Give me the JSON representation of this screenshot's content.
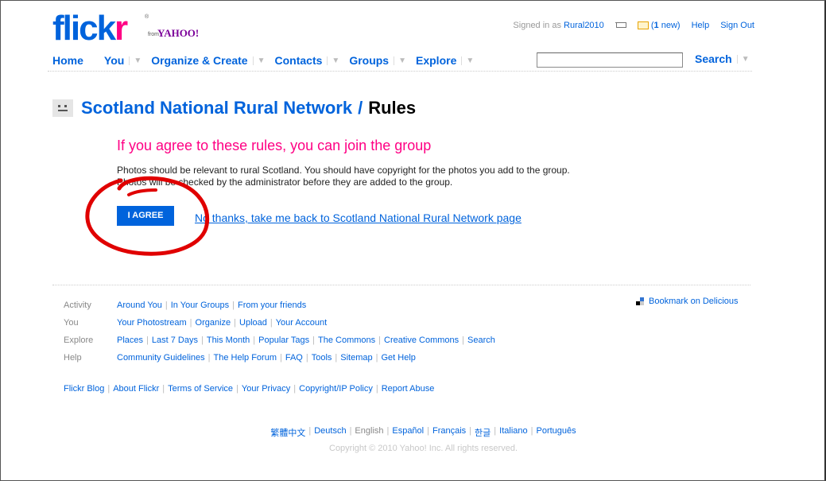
{
  "header": {
    "logo_flick": "flick",
    "logo_r": "r",
    "logo_reg": "®",
    "logo_from": "from",
    "logo_yahoo": "YAHOO!",
    "signed_in_prefix": "Signed in as",
    "username": "Rural2010",
    "mail_count": "1",
    "mail_suffix": " new)",
    "mail_prefix": "(",
    "help": "Help",
    "sign_out": "Sign Out"
  },
  "nav": {
    "home": "Home",
    "you": "You",
    "organize": "Organize & Create",
    "contacts": "Contacts",
    "groups": "Groups",
    "explore": "Explore",
    "search_value": "",
    "search_label": "Search"
  },
  "page": {
    "group_name": "Scotland National Rural Network",
    "separator": "/",
    "section": "Rules",
    "agree_heading": "If you agree to these rules, you can join the group",
    "rules_line1": "Photos should be relevant to rural Scotland. You should have copyright for the photos you add to the group.",
    "rules_line2": "Photos will be checked by the administrator before they are added to the group.",
    "agree_button": "I AGREE",
    "no_thanks": "No thanks, take me back to Scotland National Rural Network page"
  },
  "footer": {
    "rows": [
      {
        "label": "Activity",
        "links": [
          "Around You",
          "In Your Groups",
          "From your friends"
        ]
      },
      {
        "label": "You",
        "links": [
          "Your Photostream",
          "Organize",
          "Upload",
          "Your Account"
        ]
      },
      {
        "label": "Explore",
        "links": [
          "Places",
          "Last 7 Days",
          "This Month",
          "Popular Tags",
          "The Commons",
          "Creative Commons",
          "Search"
        ]
      },
      {
        "label": "Help",
        "links": [
          "Community Guidelines",
          "The Help Forum",
          "FAQ",
          "Tools",
          "Sitemap",
          "Get Help"
        ]
      }
    ],
    "bookmark": "Bookmark on Delicious",
    "bottom_links": [
      "Flickr Blog",
      "About Flickr",
      "Terms of Service",
      "Your Privacy",
      "Copyright/IP Policy",
      "Report Abuse"
    ],
    "languages": [
      "繁體中文",
      "Deutsch",
      "English",
      "Español",
      "Français",
      "한글",
      "Italiano",
      "Português"
    ],
    "current_language": "English",
    "copyright": "Copyright © 2010 Yahoo! Inc. All rights reserved."
  },
  "colors": {
    "flickr_blue": "#0063dc",
    "flickr_pink": "#ff0084",
    "annotation_red": "#e00000"
  }
}
